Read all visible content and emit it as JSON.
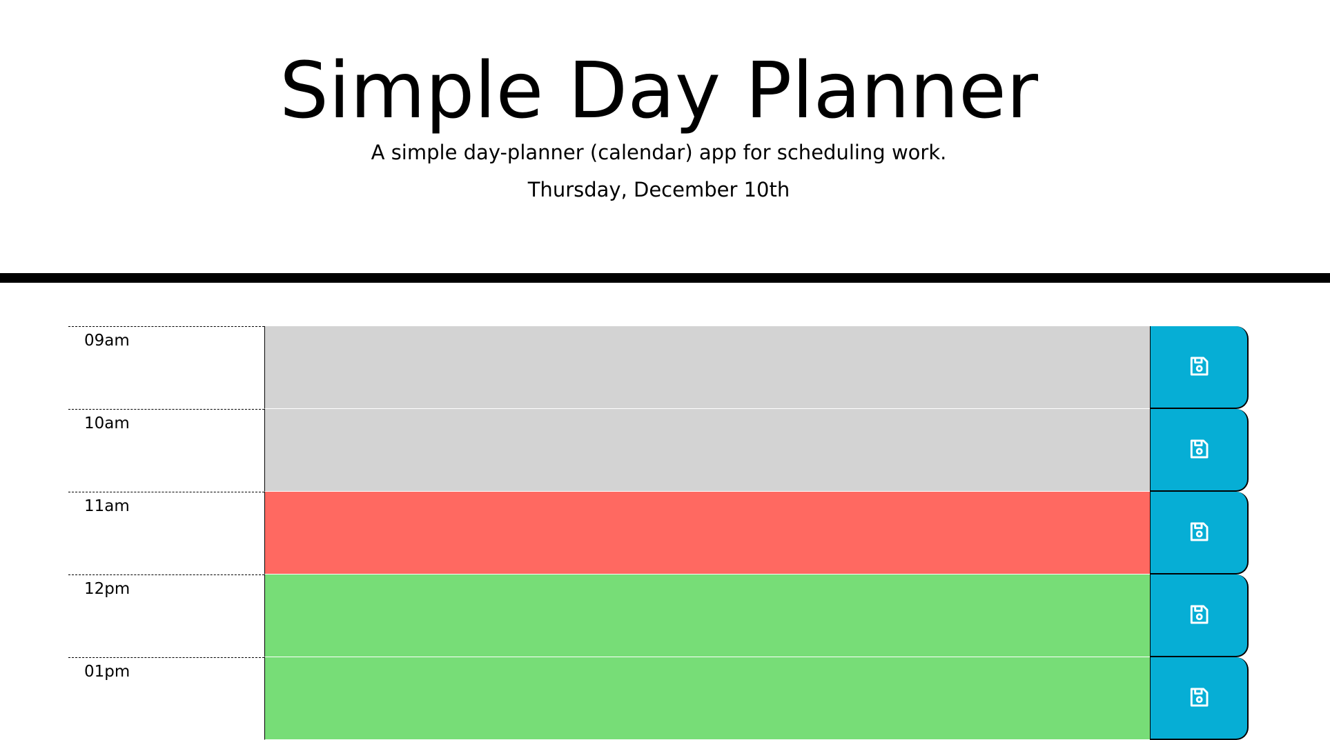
{
  "header": {
    "title": "Simple Day Planner",
    "subtitle": "A simple day-planner (calendar) app for scheduling work.",
    "current_day": "Thursday, December 10th"
  },
  "colors": {
    "past": "#d3d3d3",
    "present": "#ff6961",
    "future": "#77dd77",
    "save_button": "#06aed5"
  },
  "time_blocks": [
    {
      "hour": "09am",
      "status": "past",
      "text": "",
      "save_icon": "floppy-disk-icon"
    },
    {
      "hour": "10am",
      "status": "past",
      "text": "",
      "save_icon": "floppy-disk-icon"
    },
    {
      "hour": "11am",
      "status": "present",
      "text": "",
      "save_icon": "floppy-disk-icon"
    },
    {
      "hour": "12pm",
      "status": "future",
      "text": "",
      "save_icon": "floppy-disk-icon"
    },
    {
      "hour": "01pm",
      "status": "future",
      "text": "",
      "save_icon": "floppy-disk-icon"
    }
  ]
}
